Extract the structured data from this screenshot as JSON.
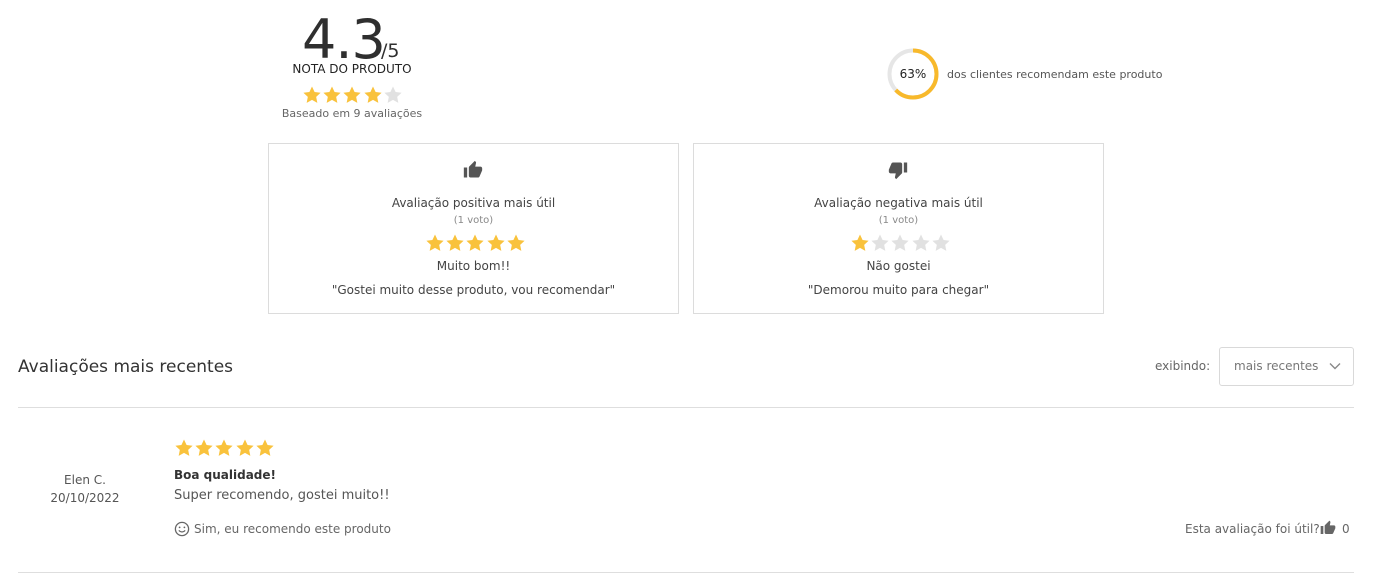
{
  "colors": {
    "star": "#f9c23c",
    "star_empty": "#e1e1e1",
    "ring": "#f8b92b",
    "ring_track": "#e6e6e6",
    "text_dark": "#2f2f2f"
  },
  "summary": {
    "score": "4.3",
    "score_max": "/5",
    "label": "NOTA DO PRODUTO",
    "rating": 4,
    "based_on": "Baseado em 9 avaliações"
  },
  "recommend": {
    "percent": 63,
    "percent_label": "63%",
    "text": "dos clientes recomendam este produto"
  },
  "positive_card": {
    "icon": "thumbs-up-icon",
    "title": "Avaliação positiva mais útil",
    "votes": "(1 voto)",
    "rating": 5,
    "headline": "Muito bom!!",
    "quote": "\"Gostei muito desse produto, vou recomendar\""
  },
  "negative_card": {
    "icon": "thumbs-down-icon",
    "title": "Avaliação negativa mais útil",
    "votes": "(1 voto)",
    "rating": 1,
    "headline": "Não gostei",
    "quote": "\"Demorou muito para chegar\""
  },
  "recent": {
    "heading": "Avaliações mais recentes",
    "sort_label": "exibindo:",
    "sort_value": "mais recentes"
  },
  "review": {
    "author": "Elen C.",
    "date": "20/10/2022",
    "rating": 5,
    "title": "Boa qualidade!",
    "body": "Super recomendo, gostei muito!!",
    "recommend_text": "Sim, eu recomendo este produto",
    "helpful_label": "Esta avaliação foi útil?",
    "helpful_count": "0"
  }
}
